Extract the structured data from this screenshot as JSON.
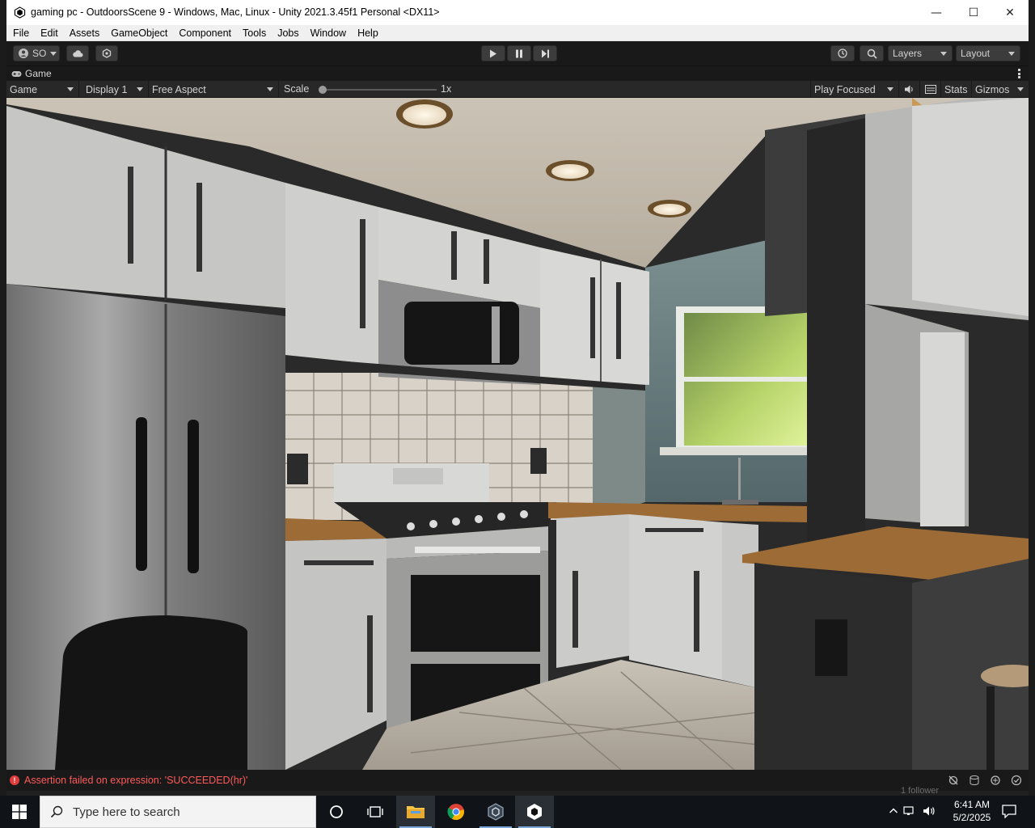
{
  "window": {
    "title": "gaming pc - OutdoorsScene 9 - Windows, Mac, Linux - Unity 2021.3.45f1 Personal <DX11>",
    "minimize_glyph": "—",
    "maximize_glyph": "☐",
    "close_glyph": "✕"
  },
  "menu": [
    "File",
    "Edit",
    "Assets",
    "GameObject",
    "Component",
    "Tools",
    "Jobs",
    "Window",
    "Help"
  ],
  "toolbar": {
    "account_label": "SO",
    "layers_label": "Layers",
    "layout_label": "Layout"
  },
  "game_panel": {
    "tab_label": "Game",
    "view_dropdown": "Game",
    "display_dropdown": "Display 1",
    "aspect_dropdown": "Free Aspect",
    "scale_label": "Scale",
    "scale_value": "1x",
    "scale_fraction": 0.0,
    "play_mode_dropdown": "Play Focused",
    "stats_label": "Stats",
    "gizmos_label": "Gizmos"
  },
  "status": {
    "message": "Assertion failed on expression: 'SUCCEEDED(hr)'",
    "error_color": "#ff5a5a"
  },
  "background_peek": {
    "followers_text": "1 follower"
  },
  "taskbar": {
    "search_placeholder": "Type here to search",
    "time": "6:41 AM",
    "date": "5/2/2025"
  },
  "colors": {
    "editor_dark": "#191919",
    "panel": "#282828",
    "accent_taskbar": "#7aa7d8"
  }
}
